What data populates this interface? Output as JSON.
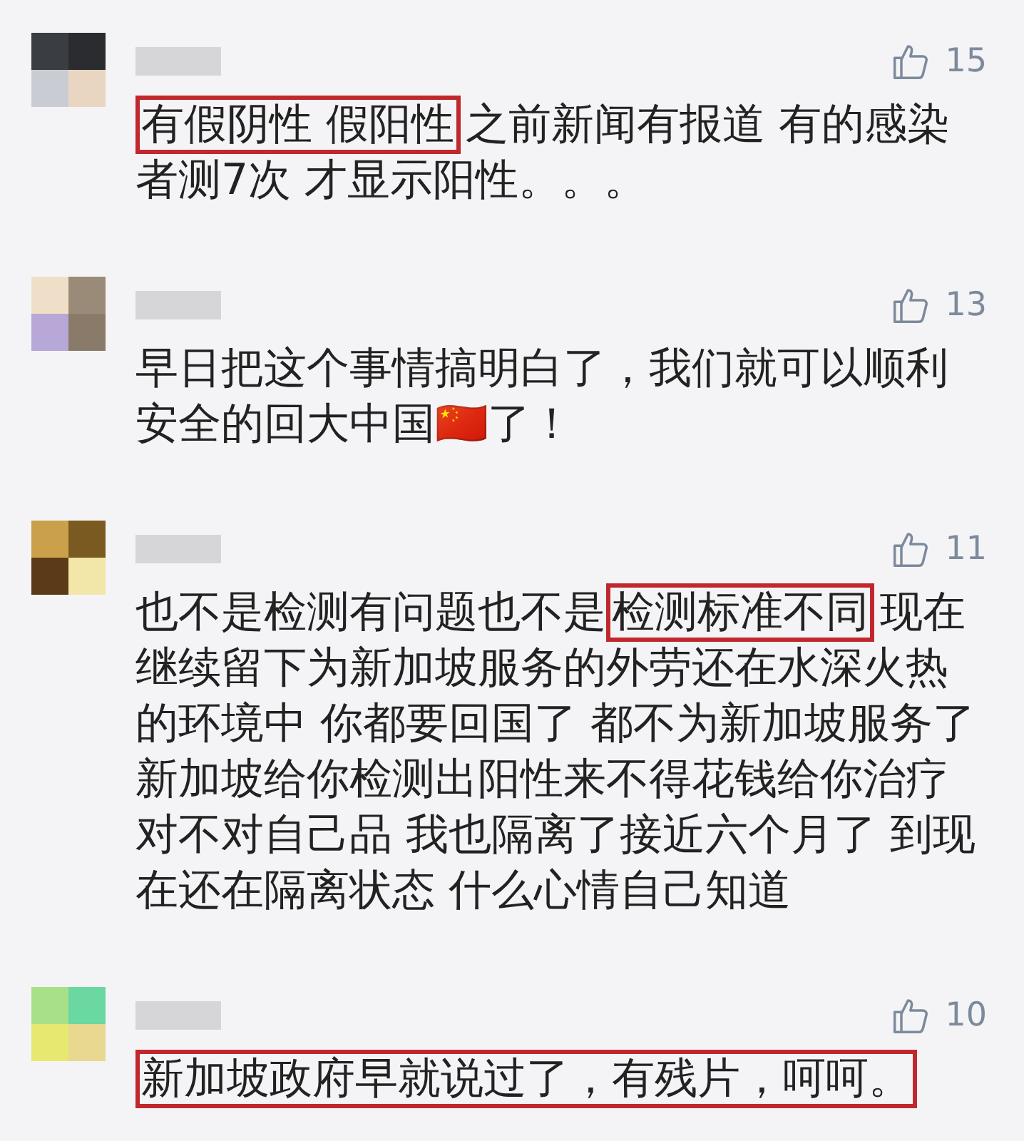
{
  "comments": [
    {
      "likes": "15",
      "segments": [
        {
          "text": "有假阴性 假阳性",
          "highlighted": true
        },
        {
          "text": "之前新闻有报道 有的感染者测7次 才显示阳性。。。",
          "highlighted": false
        }
      ]
    },
    {
      "likes": "13",
      "segments": [
        {
          "text": "早日把这个事情搞明白了，我们就可以顺利安全的回大中国🇨🇳了！",
          "highlighted": false
        }
      ]
    },
    {
      "likes": "11",
      "segments": [
        {
          "text": "也不是检测有问题也不是",
          "highlighted": false
        },
        {
          "text": "检测标准不同",
          "highlighted": true
        },
        {
          "text": "现在继续留下为新加坡服务的外劳还在水深火热的环境中 你都要回国了 都不为新加坡服务了新加坡给你检测出阳性来不得花钱给你治疗对不对自己品 我也隔离了接近六个月了 到现在还在隔离状态 什么心情自己知道",
          "highlighted": false
        }
      ]
    },
    {
      "likes": "10",
      "segments": [
        {
          "text": "新加坡政府早就说过了，有残片，呵呵。",
          "highlighted": true
        }
      ]
    }
  ]
}
